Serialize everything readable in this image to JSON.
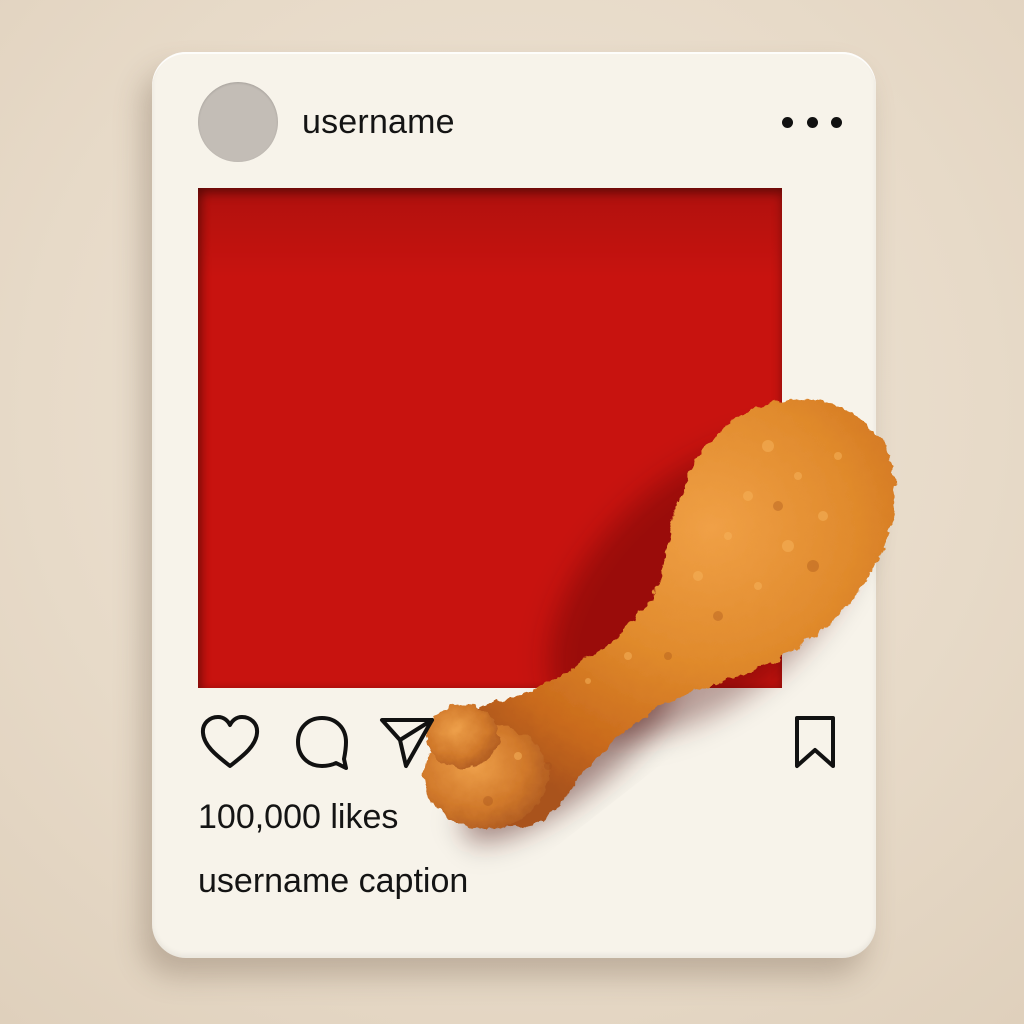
{
  "post": {
    "username": "username",
    "likes": "100,000 likes",
    "caption": "username caption",
    "avatar_color": "#c3bdb6",
    "photo_background_color": "#c8130f",
    "photo_subject": "fried-chicken-drumstick"
  },
  "icons": {
    "more": "more-horizontal-icon",
    "like": "heart-icon",
    "comment": "comment-bubble-icon",
    "share": "send-icon",
    "save": "bookmark-icon"
  },
  "colors": {
    "card": "#f7f3ea",
    "backdrop": "#e6d9c8",
    "text": "#141414"
  }
}
